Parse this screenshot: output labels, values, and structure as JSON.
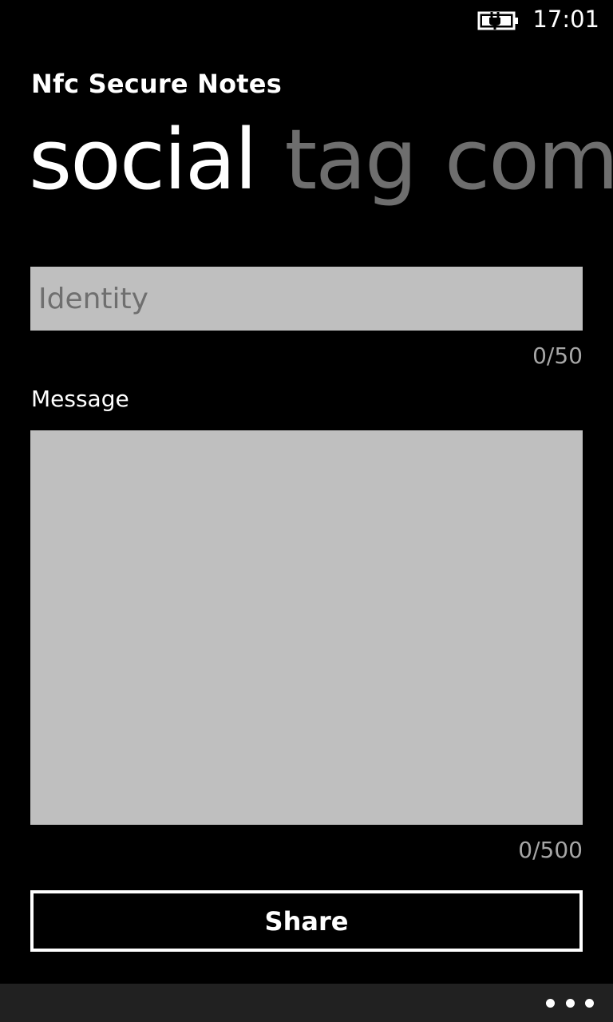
{
  "status_bar": {
    "time": "17:01",
    "battery_icon": "battery-charging-icon"
  },
  "app": {
    "title": "Nfc Secure Notes"
  },
  "pivot": {
    "items": [
      {
        "label": "social",
        "active": true
      },
      {
        "label": "tag",
        "active": false
      },
      {
        "label": "comp",
        "active": false
      }
    ]
  },
  "form": {
    "identity": {
      "placeholder": "Identity",
      "value": "",
      "counter": "0/50"
    },
    "message": {
      "label": "Message",
      "value": "",
      "counter": "0/500"
    },
    "share_label": "Share"
  },
  "app_bar": {
    "more_icon": "ellipsis-icon"
  },
  "colors": {
    "background": "#000000",
    "textbox": "#bfbfbf",
    "inactive_pivot": "#6e6e6e",
    "app_bar": "#212121"
  }
}
